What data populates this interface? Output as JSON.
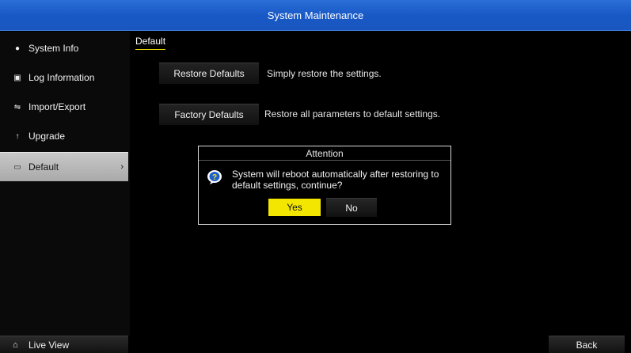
{
  "window": {
    "title": "System Maintenance"
  },
  "sidebar": {
    "items": [
      {
        "label": "System Info",
        "icon": "info-icon"
      },
      {
        "label": "Log Information",
        "icon": "log-icon"
      },
      {
        "label": "Import/Export",
        "icon": "import-export-icon"
      },
      {
        "label": "Upgrade",
        "icon": "upgrade-arrow-icon"
      },
      {
        "label": "Default",
        "icon": "default-folder-icon",
        "active": true,
        "chevron": "›"
      }
    ]
  },
  "main": {
    "tab": "Default",
    "actions": [
      {
        "button": "Restore Defaults",
        "description": "Simply restore the settings."
      },
      {
        "button": "Factory Defaults",
        "description": "Restore all parameters to default settings."
      }
    ]
  },
  "dialog": {
    "title": "Attention",
    "icon": "question-icon",
    "message": "System will reboot automatically after restoring to default settings, continue?",
    "yes_label": "Yes",
    "no_label": "No"
  },
  "footer": {
    "live_view": "Live View",
    "back": "Back"
  },
  "colors": {
    "titlebar": "#1a5bc6",
    "accent": "#f3e600",
    "background": "#000000",
    "active_item": "#b5b5b5"
  }
}
